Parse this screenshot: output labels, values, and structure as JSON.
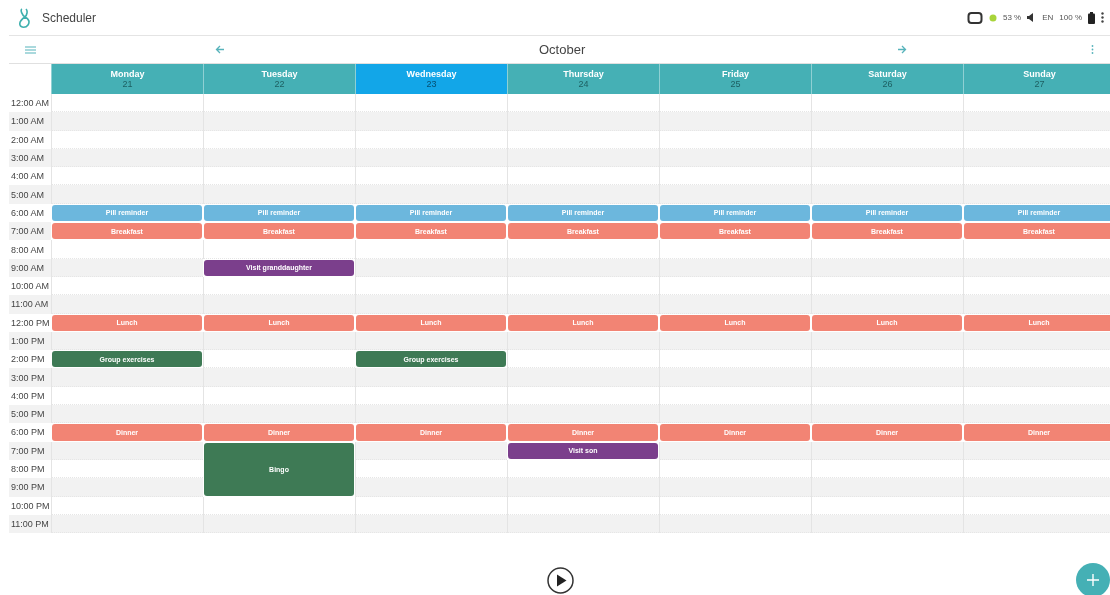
{
  "app_bar": {
    "title": "Scheduler",
    "status": {
      "battery_1": "53 %",
      "language": "EN",
      "battery_2": "100 %"
    }
  },
  "toolbar": {
    "month": "October"
  },
  "days": [
    {
      "name": "Monday",
      "date": "21",
      "selected": false
    },
    {
      "name": "Tuesday",
      "date": "22",
      "selected": false
    },
    {
      "name": "Wednesday",
      "date": "23",
      "selected": true
    },
    {
      "name": "Thursday",
      "date": "24",
      "selected": false
    },
    {
      "name": "Friday",
      "date": "25",
      "selected": false
    },
    {
      "name": "Saturday",
      "date": "26",
      "selected": false
    },
    {
      "name": "Sunday",
      "date": "27",
      "selected": false
    }
  ],
  "rows": [
    {
      "time": "12:00 AM",
      "cells": [
        null,
        null,
        null,
        null,
        null,
        null,
        null
      ]
    },
    {
      "time": "1:00 AM",
      "cells": [
        null,
        null,
        null,
        null,
        null,
        null,
        null
      ]
    },
    {
      "time": "2:00 AM",
      "cells": [
        null,
        null,
        null,
        null,
        null,
        null,
        null
      ]
    },
    {
      "time": "3:00 AM",
      "cells": [
        null,
        null,
        null,
        null,
        null,
        null,
        null
      ]
    },
    {
      "time": "4:00 AM",
      "cells": [
        null,
        null,
        null,
        null,
        null,
        null,
        null
      ]
    },
    {
      "time": "5:00 AM",
      "cells": [
        null,
        null,
        null,
        null,
        null,
        null,
        null
      ]
    },
    {
      "time": "6:00 AM",
      "cells": [
        {
          "kind": "event",
          "title": "Pill reminder",
          "color": "#6cb7dd"
        },
        {
          "kind": "event",
          "title": "Pill reminder",
          "color": "#6cb7dd"
        },
        {
          "kind": "event",
          "title": "Pill reminder",
          "color": "#6cb7dd"
        },
        {
          "kind": "event",
          "title": "Pill reminder",
          "color": "#6cb7dd"
        },
        {
          "kind": "event",
          "title": "Pill reminder",
          "color": "#6cb7dd"
        },
        {
          "kind": "event",
          "title": "Pill reminder",
          "color": "#6cb7dd"
        },
        {
          "kind": "event",
          "title": "Pill reminder",
          "color": "#6cb7dd"
        }
      ]
    },
    {
      "time": "7:00 AM",
      "cells": [
        {
          "kind": "event",
          "title": "Breakfast",
          "color": "#f28474"
        },
        {
          "kind": "event",
          "title": "Breakfast",
          "color": "#f28474"
        },
        {
          "kind": "event",
          "title": "Breakfast",
          "color": "#f28474"
        },
        {
          "kind": "event",
          "title": "Breakfast",
          "color": "#f28474"
        },
        {
          "kind": "event",
          "title": "Breakfast",
          "color": "#f28474"
        },
        {
          "kind": "event",
          "title": "Breakfast",
          "color": "#f28474"
        },
        {
          "kind": "event",
          "title": "Breakfast",
          "color": "#f28474"
        }
      ]
    },
    {
      "time": "8:00 AM",
      "cells": [
        null,
        null,
        null,
        null,
        null,
        null,
        null
      ]
    },
    {
      "time": "9:00 AM",
      "cells": [
        null,
        {
          "kind": "event",
          "title": "Visit granddaughter",
          "color": "#7b3f8c"
        },
        null,
        null,
        null,
        null,
        null
      ]
    },
    {
      "time": "10:00 AM",
      "cells": [
        null,
        null,
        null,
        null,
        null,
        null,
        null
      ]
    },
    {
      "time": "11:00 AM",
      "cells": [
        null,
        null,
        null,
        null,
        null,
        null,
        null
      ]
    },
    {
      "time": "12:00 PM",
      "cells": [
        {
          "kind": "event",
          "title": "Lunch",
          "color": "#f28474"
        },
        {
          "kind": "event",
          "title": "Lunch",
          "color": "#f28474"
        },
        {
          "kind": "event",
          "title": "Lunch",
          "color": "#f28474"
        },
        {
          "kind": "event",
          "title": "Lunch",
          "color": "#f28474"
        },
        {
          "kind": "event",
          "title": "Lunch",
          "color": "#f28474"
        },
        {
          "kind": "event",
          "title": "Lunch",
          "color": "#f28474"
        },
        {
          "kind": "event",
          "title": "Lunch",
          "color": "#f28474"
        }
      ]
    },
    {
      "time": "1:00 PM",
      "cells": [
        null,
        null,
        null,
        null,
        null,
        null,
        null
      ]
    },
    {
      "time": "2:00 PM",
      "cells": [
        {
          "kind": "event",
          "title": "Group exercises",
          "color": "#3e7a55"
        },
        null,
        {
          "kind": "event",
          "title": "Group exercises",
          "color": "#3e7a55"
        },
        null,
        null,
        null,
        null
      ]
    },
    {
      "time": "3:00 PM",
      "cells": [
        null,
        null,
        null,
        null,
        null,
        null,
        null
      ]
    },
    {
      "time": "4:00 PM",
      "cells": [
        null,
        null,
        null,
        null,
        null,
        null,
        null
      ]
    },
    {
      "time": "5:00 PM",
      "cells": [
        null,
        null,
        null,
        null,
        null,
        null,
        null
      ]
    },
    {
      "time": "6:00 PM",
      "cells": [
        {
          "kind": "event",
          "title": "Dinner",
          "color": "#f28474"
        },
        {
          "kind": "event",
          "title": "Dinner",
          "color": "#f28474"
        },
        {
          "kind": "event",
          "title": "Dinner",
          "color": "#f28474"
        },
        {
          "kind": "event",
          "title": "Dinner",
          "color": "#f28474"
        },
        {
          "kind": "event",
          "title": "Dinner",
          "color": "#f28474"
        },
        {
          "kind": "event",
          "title": "Dinner",
          "color": "#f28474"
        },
        {
          "kind": "event",
          "title": "Dinner",
          "color": "#f28474"
        }
      ]
    },
    {
      "time": "7:00 PM",
      "cells": [
        null,
        {
          "kind": "event",
          "title": "Bingo",
          "color": "#3e7a55"
        },
        null,
        {
          "kind": "event",
          "title": "Visit son",
          "color": "#7b3f8c"
        },
        null,
        null,
        null
      ]
    },
    {
      "time": "8:00 PM",
      "cells": [
        null,
        {
          "kind": "continued"
        },
        null,
        null,
        null,
        null,
        null
      ]
    },
    {
      "time": "9:00 PM",
      "cells": [
        null,
        {
          "kind": "continued"
        },
        null,
        null,
        null,
        null,
        null
      ]
    },
    {
      "time": "10:00 PM",
      "cells": [
        null,
        null,
        null,
        null,
        null,
        null,
        null
      ]
    },
    {
      "time": "11:00 PM",
      "cells": [
        null,
        null,
        null,
        null,
        null,
        null,
        null
      ]
    }
  ]
}
